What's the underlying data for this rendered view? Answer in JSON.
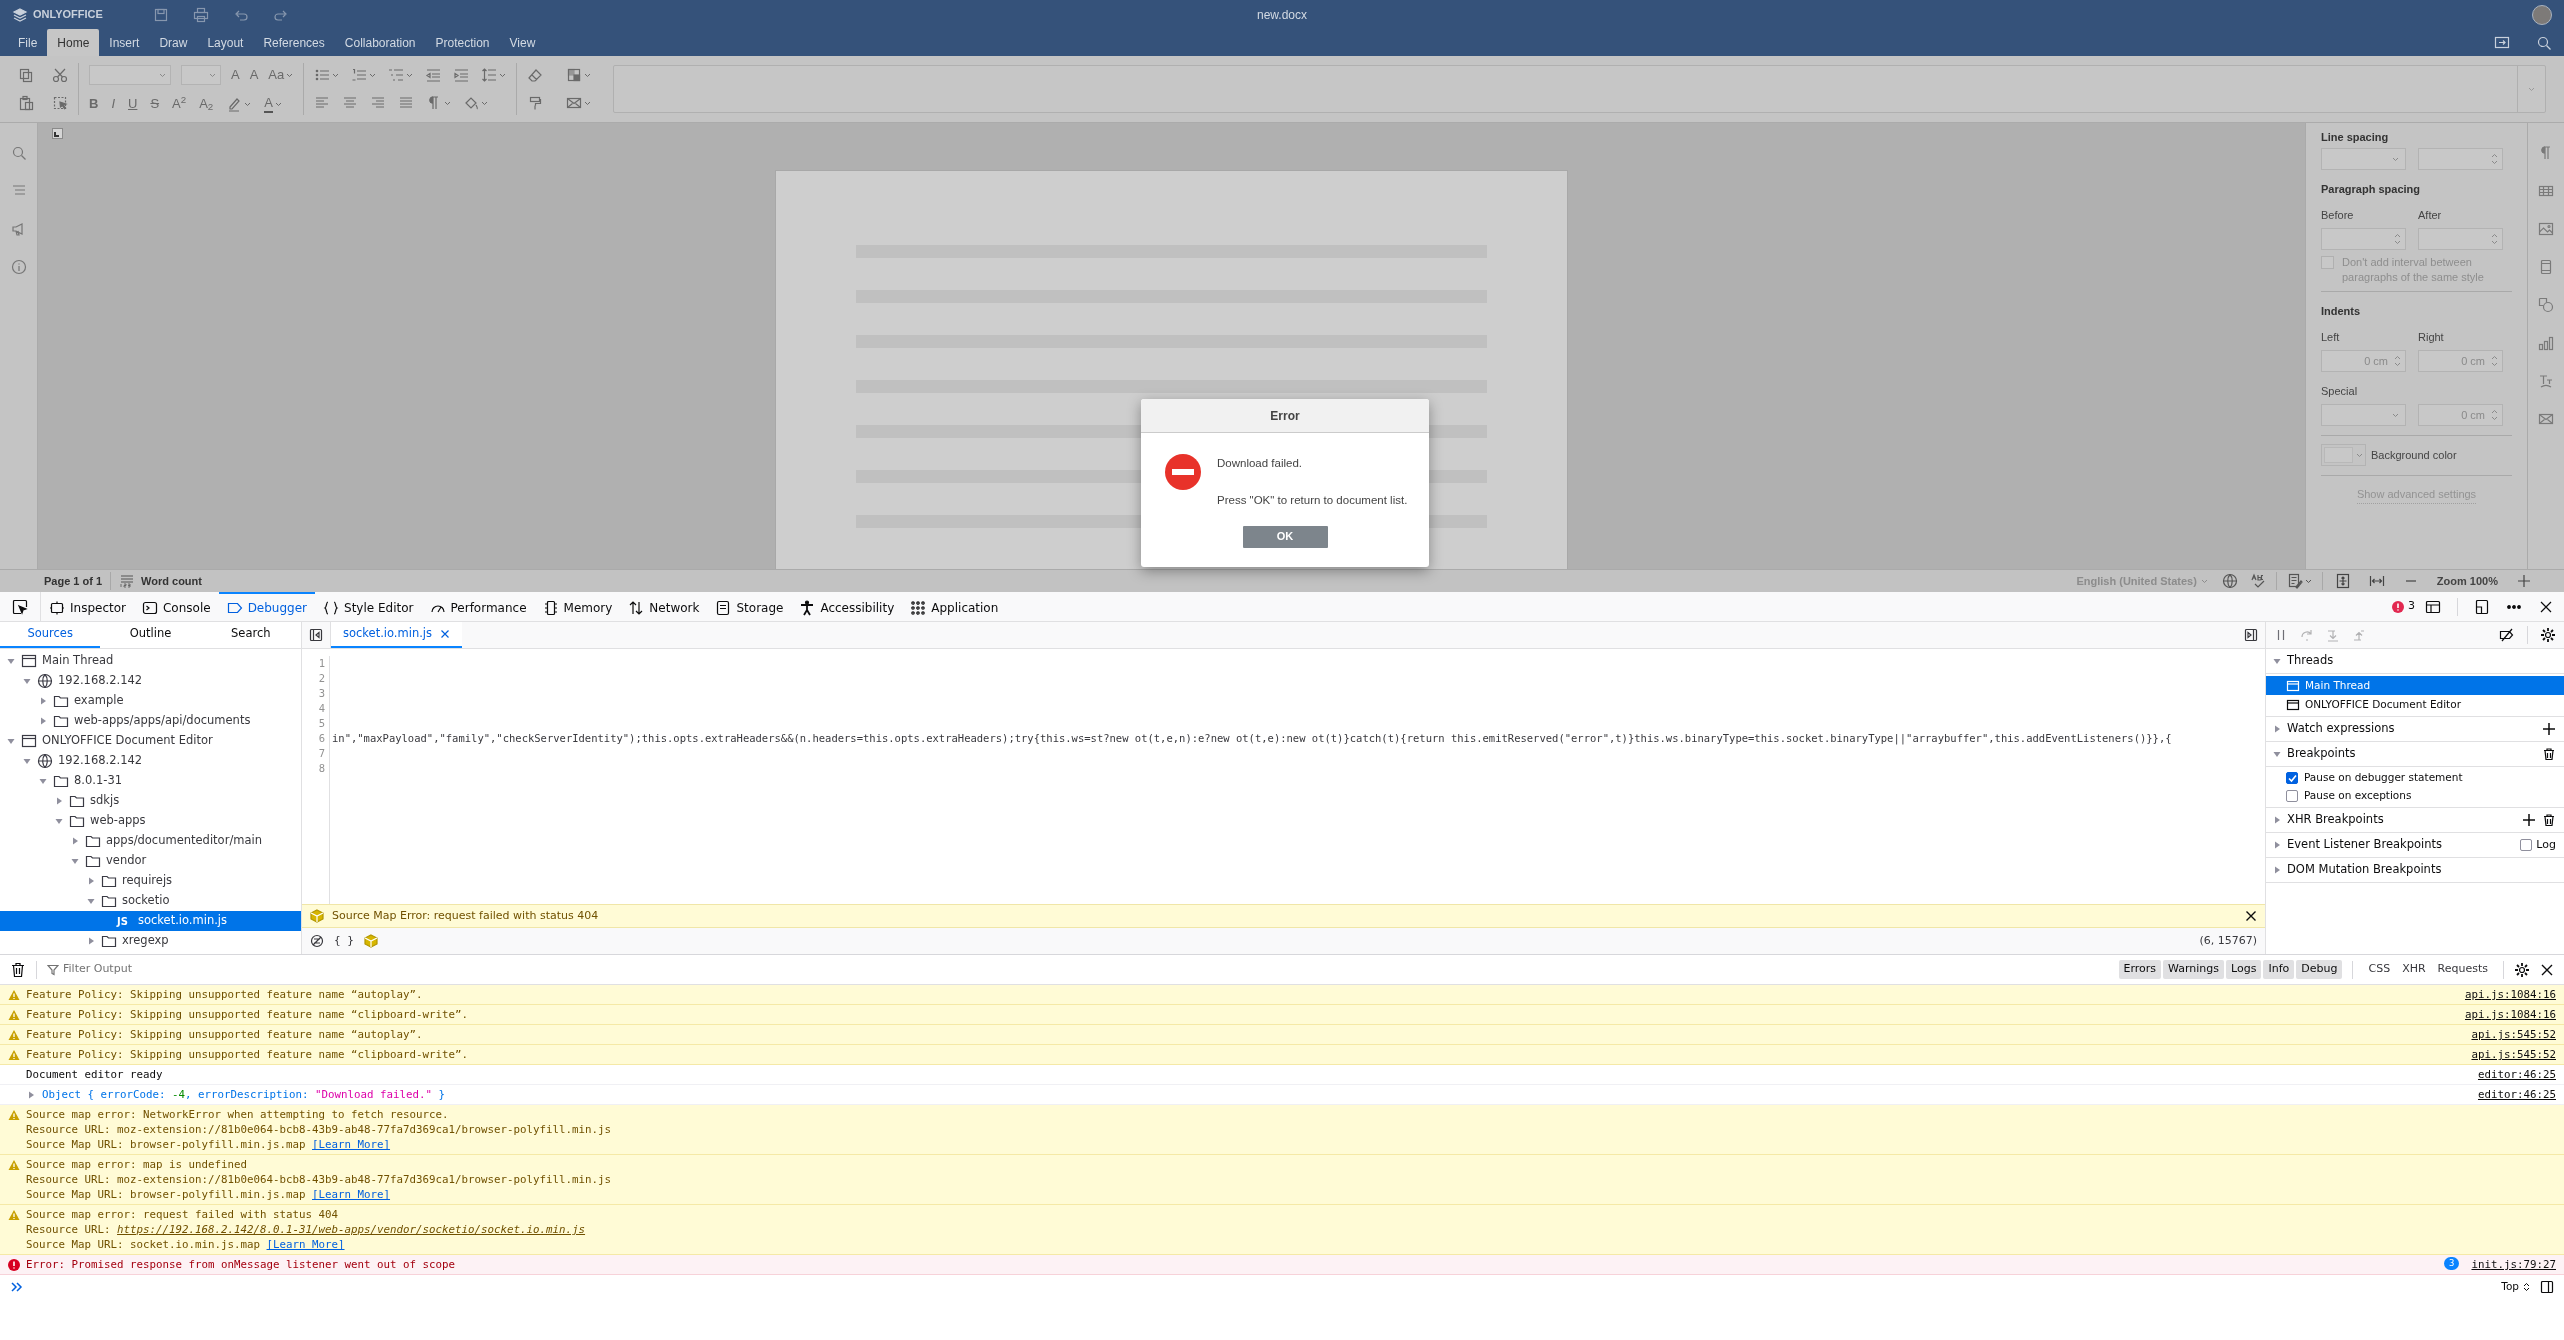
{
  "app": {
    "logo": "ONLYOFFICE",
    "document_title": "new.docx"
  },
  "menu_tabs": [
    {
      "label": "File",
      "selected": false
    },
    {
      "label": "Home",
      "selected": true
    },
    {
      "label": "Insert",
      "selected": false
    },
    {
      "label": "Draw",
      "selected": false
    },
    {
      "label": "Layout",
      "selected": false
    },
    {
      "label": "References",
      "selected": false
    },
    {
      "label": "Collaboration",
      "selected": false
    },
    {
      "label": "Protection",
      "selected": false
    },
    {
      "label": "View",
      "selected": false
    }
  ],
  "toolbar": {
    "font_buttons": [
      "A",
      "A",
      "Aa"
    ],
    "format_buttons": [
      "B",
      "I",
      "U",
      "S",
      "A$^{2}$",
      "A$_{2}$"
    ],
    "font_color": "A"
  },
  "right_panel": {
    "line_spacing": "Line spacing",
    "paragraph_spacing": "Paragraph spacing",
    "before": "Before",
    "after": "After",
    "no_interval": {
      "label": "Don't add interval between paragraphs of the same style",
      "checked": false
    },
    "indents": "Indents",
    "left": "Left",
    "right": "Right",
    "left_value": "0 cm",
    "right_value": "0 cm",
    "special": "Special",
    "special_value": "0 cm",
    "background_color": "Background color",
    "advanced": "Show advanced settings"
  },
  "status_bar": {
    "page": "Page 1 of 1",
    "word_count": "Word count",
    "language": "English (United States)",
    "zoom": "Zoom 100%"
  },
  "dialog": {
    "title": "Error",
    "message": "Download failed.",
    "hint": "Press \"OK\" to return to document list.",
    "button": "OK"
  },
  "devtools_tabs": [
    {
      "label": "Inspector",
      "selected": false
    },
    {
      "label": "Console",
      "selected": false
    },
    {
      "label": "Debugger",
      "selected": true
    },
    {
      "label": "Style Editor",
      "selected": false
    },
    {
      "label": "Performance",
      "selected": false
    },
    {
      "label": "Memory",
      "selected": false
    },
    {
      "label": "Network",
      "selected": false
    },
    {
      "label": "Storage",
      "selected": false
    },
    {
      "label": "Accessibility",
      "selected": false
    },
    {
      "label": "Application",
      "selected": false
    }
  ],
  "error_count": "3",
  "sources_tabs": [
    {
      "label": "Sources",
      "selected": true
    },
    {
      "label": "Outline",
      "selected": false
    },
    {
      "label": "Search",
      "selected": false
    }
  ],
  "tree": [
    {
      "label": "Main Thread",
      "kind": "thread",
      "expanded": true,
      "selected": false,
      "children": [
        {
          "label": "192.168.2.142",
          "kind": "host",
          "expanded": true,
          "selected": false,
          "children": [
            {
              "label": "example",
              "kind": "folder",
              "expanded": false,
              "selected": false
            },
            {
              "label": "web-apps/apps/api/documents",
              "kind": "folder",
              "expanded": false,
              "selected": false
            }
          ]
        }
      ]
    },
    {
      "label": "ONLYOFFICE Document Editor",
      "kind": "thread",
      "expanded": true,
      "selected": false,
      "children": [
        {
          "label": "192.168.2.142",
          "kind": "host",
          "expanded": true,
          "selected": false,
          "children": [
            {
              "label": "8.0.1-31",
              "kind": "folder",
              "expanded": true,
              "selected": false,
              "children": [
                {
                  "label": "sdkjs",
                  "kind": "folder",
                  "expanded": false,
                  "selected": false
                },
                {
                  "label": "web-apps",
                  "kind": "folder",
                  "expanded": true,
                  "selected": false,
                  "children": [
                    {
                      "label": "apps/documenteditor/main",
                      "kind": "folder",
                      "expanded": false,
                      "selected": false
                    },
                    {
                      "label": "vendor",
                      "kind": "folder",
                      "expanded": true,
                      "selected": false,
                      "children": [
                        {
                          "label": "requirejs",
                          "kind": "folder",
                          "expanded": false,
                          "selected": false
                        },
                        {
                          "label": "socketio",
                          "kind": "folder",
                          "expanded": true,
                          "selected": false,
                          "children": [
                            {
                              "label": "socket.io.min.js",
                              "kind": "file",
                              "badge": "JS",
                              "selected": true
                            }
                          ]
                        },
                        {
                          "label": "xregexp",
                          "kind": "folder",
                          "expanded": false,
                          "selected": false
                        }
                      ]
                    }
                  ]
                }
              ]
            }
          ]
        }
      ]
    }
  ],
  "editor_tab": {
    "label": "socket.io.min.js",
    "selected": true
  },
  "code_lines": [
    {
      "number": "1"
    },
    {
      "number": "2"
    },
    {
      "number": "3"
    },
    {
      "number": "4"
    },
    {
      "number": "5"
    },
    {
      "number": "6",
      "code": "in\",\"maxPayload\",\"family\",\"checkServerIdentity\");this.opts.extraHeaders&&(n.headers=this.opts.extraHeaders);try{this.ws=st?new ot(t,e,n):e?new ot(t,e):new ot(t)}catch(t){return this.emitReserved(\"error\",t)}this.ws.binaryType=this.socket.binaryType||\"arraybuffer\",this.addEventListeners()}},{"
    },
    {
      "number": "7"
    },
    {
      "number": "8"
    }
  ],
  "source_map_error": "Source Map Error: request failed with status 404",
  "pretty_print": "{ }",
  "cursor_position": "(6, 15767)",
  "debugger_panes": [
    {
      "title": "Threads",
      "kind": "threads",
      "expanded": true,
      "items": [
        {
          "label": "Main Thread",
          "selected": true
        },
        {
          "label": "ONLYOFFICE Document Editor",
          "selected": false
        }
      ]
    },
    {
      "title": "Watch expressions",
      "kind": "watch",
      "expanded": false
    },
    {
      "title": "Breakpoints",
      "kind": "breakpoints",
      "expanded": true,
      "items": [
        {
          "label": "Pause on debugger statement",
          "checked": true
        },
        {
          "label": "Pause on exceptions",
          "checked": false
        }
      ]
    },
    {
      "title": "XHR Breakpoints",
      "kind": "xhr",
      "expanded": false
    },
    {
      "title": "Event Listener Breakpoints",
      "kind": "events",
      "expanded": false,
      "log": {
        "label": "Log",
        "checked": false
      }
    },
    {
      "title": "DOM Mutation Breakpoints",
      "kind": "dom",
      "expanded": false
    }
  ],
  "console": {
    "filter_placeholder": "Filter Output",
    "levels": [
      {
        "label": "Errors",
        "selected": true
      },
      {
        "label": "Warnings",
        "selected": true
      },
      {
        "label": "Logs",
        "selected": true
      },
      {
        "label": "Info",
        "selected": true
      },
      {
        "label": "Debug",
        "selected": true
      }
    ],
    "extra_filters": [
      {
        "label": "CSS",
        "selected": false
      },
      {
        "label": "XHR",
        "selected": false
      },
      {
        "label": "Requests",
        "selected": false
      }
    ],
    "messages": [
      {
        "kind": "warning",
        "lines": [
          {
            "text": "Feature Policy: Skipping unsupported feature name “autoplay”."
          }
        ],
        "location": "api.js:1084:16"
      },
      {
        "kind": "warning",
        "lines": [
          {
            "text": "Feature Policy: Skipping unsupported feature name “clipboard-write”."
          }
        ],
        "location": "api.js:1084:16"
      },
      {
        "kind": "warning",
        "lines": [
          {
            "text": "Feature Policy: Skipping unsupported feature name “autoplay”."
          }
        ],
        "location": "api.js:545:52"
      },
      {
        "kind": "warning",
        "lines": [
          {
            "text": "Feature Policy: Skipping unsupported feature name “clipboard-write”."
          }
        ],
        "location": "api.js:545:52"
      },
      {
        "kind": "log",
        "lines": [
          {
            "text": "Document editor ready"
          }
        ],
        "location": "editor:46:25"
      },
      {
        "kind": "object",
        "expanded": false,
        "parts": [
          {
            "text": "Object { errorCode: ",
            "kind": "key"
          },
          {
            "text": "-4",
            "kind": "number"
          },
          {
            "text": ", errorDescription: ",
            "kind": "key"
          },
          {
            "text": "\"Download failed.\"",
            "kind": "string"
          },
          {
            "text": " }",
            "kind": "key"
          }
        ],
        "location": "editor:46:25"
      },
      {
        "kind": "warning",
        "lines": [
          {
            "text": "Source map error: NetworkError when attempting to fetch resource."
          },
          {
            "text": "Resource URL: moz-extension://81b0e064-bcb8-43b9-ab48-77fa7d369ca1/browser-polyfill.min.js"
          },
          {
            "text": "Source Map URL: browser-polyfill.min.js.map",
            "link": "[Learn More]",
            "kind": "help"
          }
        ]
      },
      {
        "kind": "warning",
        "lines": [
          {
            "text": "Source map error: map is undefined"
          },
          {
            "text": "Resource URL: moz-extension://81b0e064-bcb8-43b9-ab48-77fa7d369ca1/browser-polyfill.min.js"
          },
          {
            "text": "Source Map URL: browser-polyfill.min.js.map",
            "link": "[Learn More]",
            "kind": "help"
          }
        ]
      },
      {
        "kind": "warning",
        "lines": [
          {
            "text": "Source map error: request failed with status 404"
          },
          {
            "text": "Resource URL:",
            "link": "https://192.168.2.142/8.0.1-31/web-apps/vendor/socketio/socket.io.min.js",
            "kind": "resource"
          },
          {
            "text": "Source Map URL: socket.io.min.js.map",
            "link": "[Learn More]",
            "kind": "help"
          }
        ]
      },
      {
        "kind": "error",
        "lines": [
          {
            "text": "Error: Promised response from onMessage listener went out of scope"
          }
        ],
        "repeat": "3",
        "location": "init.js:79:27"
      }
    ],
    "context": "Top"
  }
}
